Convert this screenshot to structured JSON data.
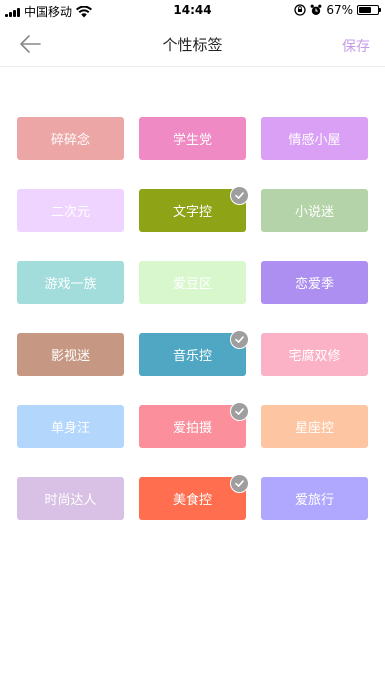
{
  "status_bar": {
    "carrier": "中国移动",
    "time": "14:44",
    "battery": "67%",
    "battery_level": 0.67,
    "icons": [
      "signal-icon",
      "wifi-icon",
      "rotation-lock-icon",
      "alarm-icon",
      "battery-icon"
    ]
  },
  "nav": {
    "title": "个性标签",
    "save_label": "保存",
    "back_icon": "arrow-left-icon",
    "save_color": "#c79bea"
  },
  "tags": [
    {
      "label": "碎碎念",
      "color": "#eda6a6",
      "selected": false
    },
    {
      "label": "学生党",
      "color": "#ef8ac4",
      "selected": false
    },
    {
      "label": "情感小屋",
      "color": "#d9a0f6",
      "selected": false
    },
    {
      "label": "二次元",
      "color": "#eed4fe",
      "selected": false
    },
    {
      "label": "文字控",
      "color": "#8ea416",
      "selected": true
    },
    {
      "label": "小说迷",
      "color": "#b4d3a8",
      "selected": false
    },
    {
      "label": "游戏一族",
      "color": "#a2dcdb",
      "selected": false
    },
    {
      "label": "爱豆区",
      "color": "#d9f7cc",
      "selected": false
    },
    {
      "label": "恋爱季",
      "color": "#ac8ff0",
      "selected": false
    },
    {
      "label": "影视迷",
      "color": "#c69883",
      "selected": false
    },
    {
      "label": "音乐控",
      "color": "#4fa7c3",
      "selected": true
    },
    {
      "label": "宅腐双修",
      "color": "#fbb2c7",
      "selected": false
    },
    {
      "label": "单身汪",
      "color": "#b3d6fc",
      "selected": false
    },
    {
      "label": "爱拍摄",
      "color": "#fb8f9c",
      "selected": true
    },
    {
      "label": "星座控",
      "color": "#fec5a2",
      "selected": false
    },
    {
      "label": "时尚达人",
      "color": "#d8c1e4",
      "selected": false
    },
    {
      "label": "美食控",
      "color": "#fe6e4f",
      "selected": true
    },
    {
      "label": "爱旅行",
      "color": "#b0a8fe",
      "selected": false
    }
  ]
}
